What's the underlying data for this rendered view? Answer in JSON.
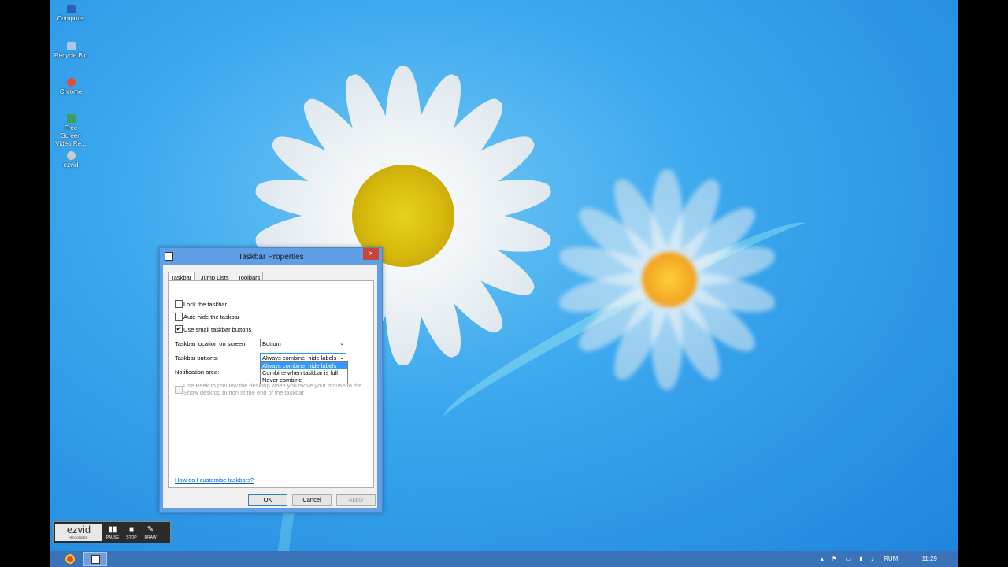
{
  "desktop_icons": [
    {
      "label": "Computer",
      "icon": "computer-icon",
      "color": "#2a5fb5"
    },
    {
      "label": "Recycle Bin",
      "icon": "recycle-bin-icon",
      "color": "#a9c7e8"
    },
    {
      "label": "Chrome",
      "icon": "chrome-icon",
      "color": "#e14b3c"
    },
    {
      "label": "Free Screen Video Re...",
      "icon": "recorder-icon",
      "color": "#3aa05a"
    },
    {
      "label": "ezvid",
      "icon": "ezvid-icon",
      "color": "#cccccc"
    }
  ],
  "dialog": {
    "title": "Taskbar Properties",
    "close_symbol": "×",
    "tabs": [
      "Taskbar",
      "Jump Lists",
      "Toolbars"
    ],
    "active_tab": "Taskbar",
    "checkboxes": [
      {
        "label": "Lock the taskbar",
        "checked": false,
        "mark": ""
      },
      {
        "label": "Auto-hide the taskbar",
        "checked": false,
        "mark": ""
      },
      {
        "label": "Use small taskbar buttons",
        "checked": true,
        "mark": "✔"
      }
    ],
    "location_label": "Taskbar location on screen:",
    "location_value": "Bottom",
    "buttons_label": "Taskbar buttons:",
    "buttons_value": "Always combine, hide labels",
    "buttons_options": [
      "Always combine, hide labels",
      "Combine when taskbar is full",
      "Never combine"
    ],
    "notification_label": "Notification area:",
    "peek_text": "Use Peek to preview the desktop when you move your mouse to the Show desktop button at the end of the taskbar",
    "help_link": "How do I customise taskbars?",
    "ok": "OK",
    "cancel": "Cancel",
    "apply": "Apply"
  },
  "recorder": {
    "logo": "ezvid",
    "logo_sub": "RECORDER",
    "buttons": [
      {
        "label": "PAUSE",
        "icon": "pause-icon",
        "symbol": "▮▮"
      },
      {
        "label": "STOP",
        "icon": "stop-icon",
        "symbol": "■"
      },
      {
        "label": "DRAW",
        "icon": "pen-icon",
        "symbol": "✎"
      }
    ]
  },
  "taskbar": {
    "language": "RUM",
    "time": "11:29"
  },
  "colors": {
    "accent": "#3b73b9",
    "dialog_frame": "#5f9fe6",
    "close": "#c7463a",
    "selection": "#3399ff"
  }
}
